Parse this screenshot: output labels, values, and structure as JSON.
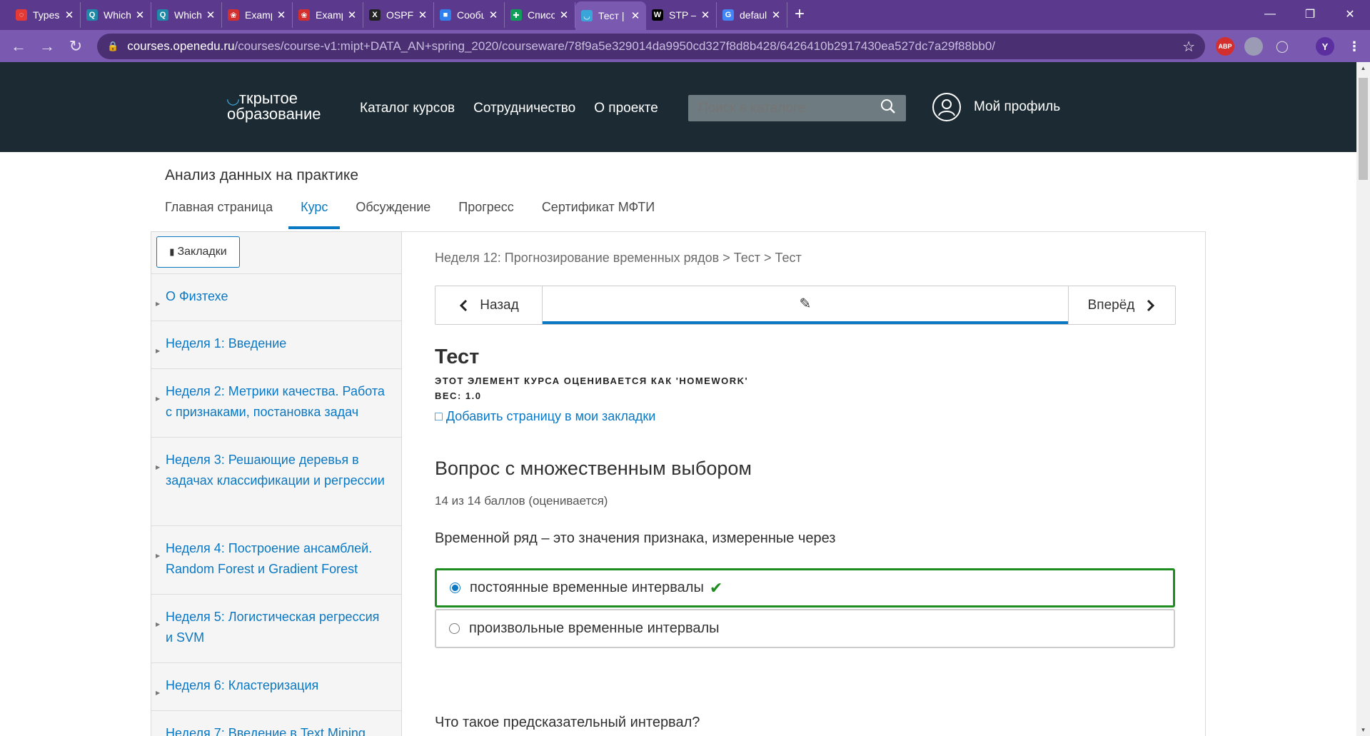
{
  "browser": {
    "tabs": [
      {
        "label": "Types of R",
        "icon": "spinner-icon",
        "color": "#e53935"
      },
      {
        "label": "Which of t",
        "icon": "q-icon",
        "color": "#1e88a8"
      },
      {
        "label": "Which of t",
        "icon": "q-icon",
        "color": "#1e88a8"
      },
      {
        "label": "Example f",
        "icon": "huawei-icon",
        "color": "#d32f2f"
      },
      {
        "label": "Example f",
        "icon": "huawei-icon",
        "color": "#d32f2f"
      },
      {
        "label": "OSPF — X",
        "icon": "habr-icon",
        "color": "#222222"
      },
      {
        "label": "Сообщени",
        "icon": "chat-icon",
        "color": "#2f80ed"
      },
      {
        "label": "Список - (",
        "icon": "sheets-icon",
        "color": "#0f9d58"
      },
      {
        "label": "Тест | Тес",
        "icon": "openedu-icon",
        "color": "#3aa5d8"
      },
      {
        "label": "STP — Ви",
        "icon": "wikipedia-icon",
        "color": "#000000"
      },
      {
        "label": "default va",
        "icon": "google-icon",
        "color": "#4285f4"
      }
    ],
    "active_tab": 8,
    "url_host": "courses.openedu.ru",
    "url_path": "/courses/course-v1:mipt+DATA_AN+spring_2020/courseware/78f9a5e329014da9950cd327f8d8b428/6426410b2917430ea527dc7a29f88bb0/",
    "ext_abp": "ABP",
    "profile_initial": "Y"
  },
  "site": {
    "logo_line1": "ткрытое",
    "logo_line2": "образование",
    "nav": [
      "Каталог курсов",
      "Сотрудничество",
      "О проекте"
    ],
    "search_placeholder": "Поиск в каталоге",
    "profile_label": "Мой профиль"
  },
  "course": {
    "title": "Анализ данных на практике",
    "tabs": [
      "Главная страница",
      "Курс",
      "Обсуждение",
      "Прогресс",
      "Сертификат МФТИ"
    ],
    "active_tab": 1
  },
  "sidebar": {
    "bookmarks_label": "Закладки",
    "chapters": [
      "О Физтехе",
      "Неделя 1: Введение",
      "Неделя 2: Метрики качества. Работа с признаками, постановка задач",
      "Неделя 3: Решающие деревья в задачах классификации и регрессии",
      "Неделя 4: Построение ансамблей. Random Forest и Gradient Forest",
      "Неделя 5: Логистическая регрессия и SVM",
      "Неделя 6: Кластеризация",
      "Неделя 7: Введение в Text Mining"
    ]
  },
  "unit": {
    "breadcrumb": "Неделя 12: Прогнозирование временных рядов > Тест > Тест",
    "prev_label": "Назад",
    "next_label": "Вперёд",
    "title": "Тест",
    "graded_as": "ЭТОТ ЭЛЕМЕНТ КУРСА ОЦЕНИВАЕТСЯ КАК 'HOMEWORK'",
    "weight": "ВЕС: 1.0",
    "add_bookmark": "Добавить страницу в мои закладки"
  },
  "problem": {
    "heading": "Вопрос с множественным выбором",
    "points": "14 из 14 баллов (оценивается)",
    "question": "Временной ряд – это значения признака, измеренные через",
    "options": [
      {
        "label": "постоянные временные интервалы",
        "selected": true,
        "correct": true
      },
      {
        "label": "произвольные временные интервалы",
        "selected": false,
        "correct": false
      }
    ],
    "next_question": "Что такое предсказательный интервал?"
  }
}
